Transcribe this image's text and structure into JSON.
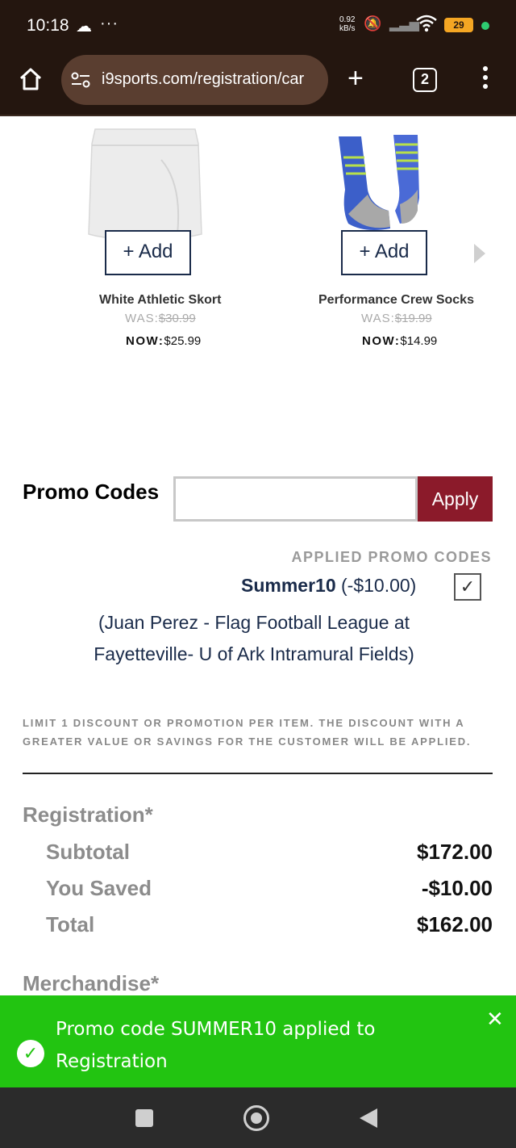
{
  "status_bar": {
    "time": "10:18",
    "overflow": "···",
    "net_speed_value": "0.92",
    "net_speed_unit": "kB/s",
    "battery": "29",
    "icons": [
      "cloud-icon",
      "mute-icon",
      "signal-icon",
      "wifi-icon",
      "battery-icon"
    ]
  },
  "browser": {
    "url": "i9sports.com/registration/car",
    "tab_count": "2"
  },
  "products": [
    {
      "name": "White Athletic Skort",
      "add_label": "+ Add",
      "was_label": "WAS:",
      "was_price": "$30.99",
      "now_label": "NOW:",
      "now_price": "$25.99"
    },
    {
      "name": "Performance Crew Socks",
      "add_label": "+ Add",
      "was_label": "WAS:",
      "was_price": "$19.99",
      "now_label": "NOW:",
      "now_price": "$14.99"
    }
  ],
  "promo": {
    "label": "Promo Codes",
    "input_value": "",
    "apply_label": "Apply",
    "applied_header": "APPLIED PROMO CODES",
    "code": "Summer10",
    "code_amount": "(-$10.00)",
    "code_checked": true,
    "code_desc": "(Juan Perez - Flag Football League at Fayetteville- U of Ark Intramural Fields)",
    "limit_notice": "LIMIT 1 DISCOUNT OR PROMOTION PER ITEM. THE DISCOUNT WITH A GREATER VALUE OR SAVINGS FOR THE CUSTOMER WILL BE APPLIED."
  },
  "summary": {
    "registration_header": "Registration*",
    "subtotal_label": "Subtotal",
    "subtotal_value": "$172.00",
    "saved_label": "You Saved",
    "saved_value": "-$10.00",
    "total_label": "Total",
    "total_value": "$162.00",
    "merch_header": "Merchandise*"
  },
  "toast": {
    "message": "Promo code SUMMER10 applied to Registration",
    "color": "#22c411"
  },
  "colors": {
    "brand_navy": "#1a2b4a",
    "apply_red": "#8b1a2a",
    "chrome_dark": "#24160f"
  }
}
